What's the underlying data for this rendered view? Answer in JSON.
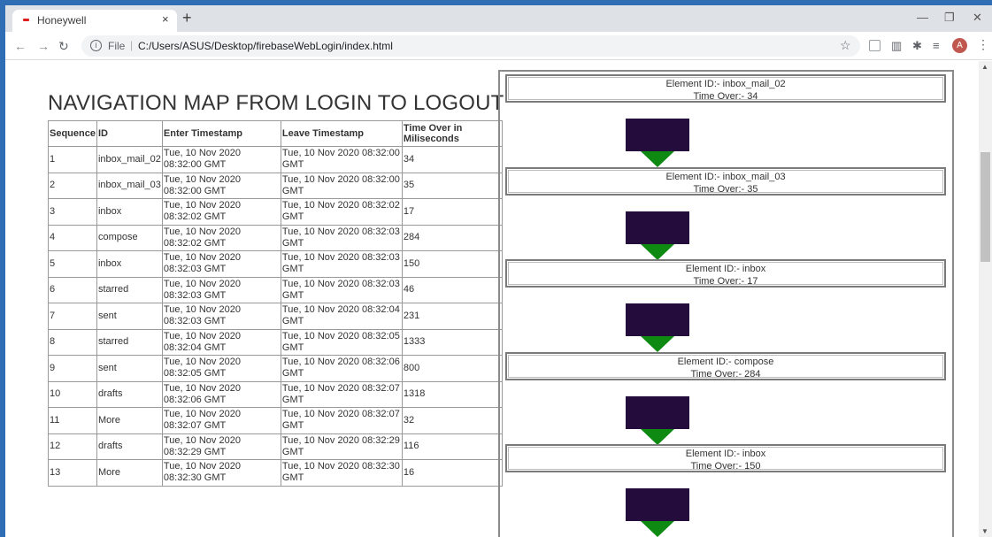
{
  "browser": {
    "tab_title": "Honeywell",
    "tab_close": "×",
    "new_tab": "+",
    "url_scheme": "File",
    "url_separator": "|",
    "url": "C:/Users/ASUS/Desktop/firebaseWebLogin/index.html",
    "avatar_letter": "A",
    "icons": [
      "back-icon",
      "forward-icon",
      "reload-icon",
      "info-icon",
      "star-icon",
      "extensions-icon",
      "menu-icon"
    ]
  },
  "page": {
    "title": "NAVIGATION MAP FROM LOGIN TO LOGOUT",
    "table": {
      "headers": [
        "Sequence",
        "ID",
        "Enter Timestamp",
        "Leave Timestamp",
        "Time Over in Miliseconds"
      ],
      "rows": [
        [
          "1",
          "inbox_mail_02",
          "Tue, 10 Nov 2020 08:32:00 GMT",
          "Tue, 10 Nov 2020 08:32:00 GMT",
          "34"
        ],
        [
          "2",
          "inbox_mail_03",
          "Tue, 10 Nov 2020 08:32:00 GMT",
          "Tue, 10 Nov 2020 08:32:00 GMT",
          "35"
        ],
        [
          "3",
          "inbox",
          "Tue, 10 Nov 2020 08:32:02 GMT",
          "Tue, 10 Nov 2020 08:32:02 GMT",
          "17"
        ],
        [
          "4",
          "compose",
          "Tue, 10 Nov 2020 08:32:02 GMT",
          "Tue, 10 Nov 2020 08:32:03 GMT",
          "284"
        ],
        [
          "5",
          "inbox",
          "Tue, 10 Nov 2020 08:32:03 GMT",
          "Tue, 10 Nov 2020 08:32:03 GMT",
          "150"
        ],
        [
          "6",
          "starred",
          "Tue, 10 Nov 2020 08:32:03 GMT",
          "Tue, 10 Nov 2020 08:32:03 GMT",
          "46"
        ],
        [
          "7",
          "sent",
          "Tue, 10 Nov 2020 08:32:03 GMT",
          "Tue, 10 Nov 2020 08:32:04 GMT",
          "231"
        ],
        [
          "8",
          "starred",
          "Tue, 10 Nov 2020 08:32:04 GMT",
          "Tue, 10 Nov 2020 08:32:05 GMT",
          "1333"
        ],
        [
          "9",
          "sent",
          "Tue, 10 Nov 2020 08:32:05 GMT",
          "Tue, 10 Nov 2020 08:32:06 GMT",
          "800"
        ],
        [
          "10",
          "drafts",
          "Tue, 10 Nov 2020 08:32:06 GMT",
          "Tue, 10 Nov 2020 08:32:07 GMT",
          "1318"
        ],
        [
          "11",
          "More",
          "Tue, 10 Nov 2020 08:32:07 GMT",
          "Tue, 10 Nov 2020 08:32:07 GMT",
          "32"
        ],
        [
          "12",
          "drafts",
          "Tue, 10 Nov 2020 08:32:29 GMT",
          "Tue, 10 Nov 2020 08:32:29 GMT",
          "116"
        ],
        [
          "13",
          "More",
          "Tue, 10 Nov 2020 08:32:30 GMT",
          "Tue, 10 Nov 2020 08:32:30 GMT",
          "16"
        ]
      ]
    },
    "flow": [
      {
        "element": "Element ID:- inbox_mail_02",
        "time": "Time Over:- 34"
      },
      {
        "element": "Element ID:- inbox_mail_03",
        "time": "Time Over:- 35"
      },
      {
        "element": "Element ID:- inbox",
        "time": "Time Over:- 17"
      },
      {
        "element": "Element ID:- compose",
        "time": "Time Over:- 284"
      },
      {
        "element": "Element ID:- inbox",
        "time": "Time Over:- 150"
      }
    ],
    "colors": {
      "flow_block": "#240c3d",
      "flow_arrow": "#0e8a13"
    }
  }
}
